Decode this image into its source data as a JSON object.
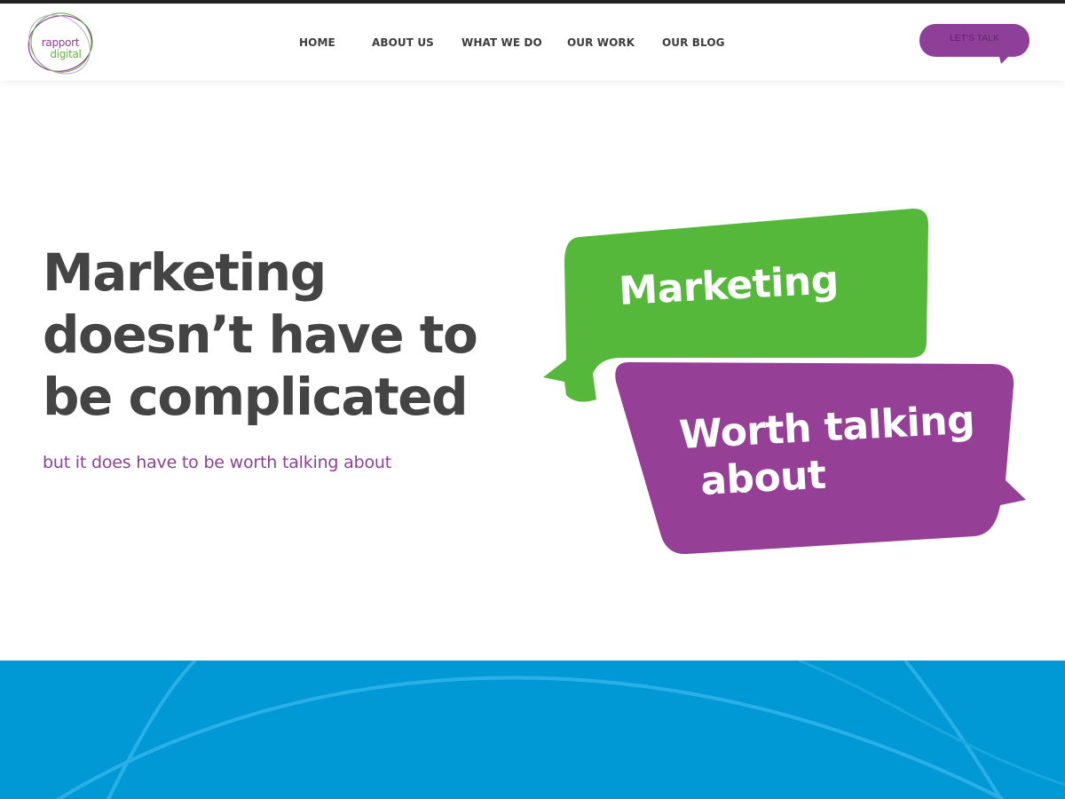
{
  "brand": {
    "logo_line1": "rapport",
    "logo_line2": "digital",
    "purple": "#8e3f97",
    "green": "#56b83b",
    "blue": "#0099d6",
    "text_dark": "#444444"
  },
  "nav": {
    "items": [
      {
        "label": "HOME"
      },
      {
        "label": "ABOUT US"
      },
      {
        "label": "WHAT WE DO"
      },
      {
        "label": "OUR WORK"
      },
      {
        "label": "OUR BLOG"
      }
    ]
  },
  "cta": {
    "label": "LET'S TALK"
  },
  "hero": {
    "title_lines": [
      "Marketing",
      "doesn’t have to",
      "be complicated"
    ],
    "subtitle": "but it does have to be worth talking about"
  },
  "bubbles": {
    "green_text": "Marketing",
    "purple_line1": "Worth talking",
    "purple_line2": "about"
  },
  "icons": {
    "logo": "circular-swirl-logo",
    "cta_shape": "speech-bubble"
  }
}
